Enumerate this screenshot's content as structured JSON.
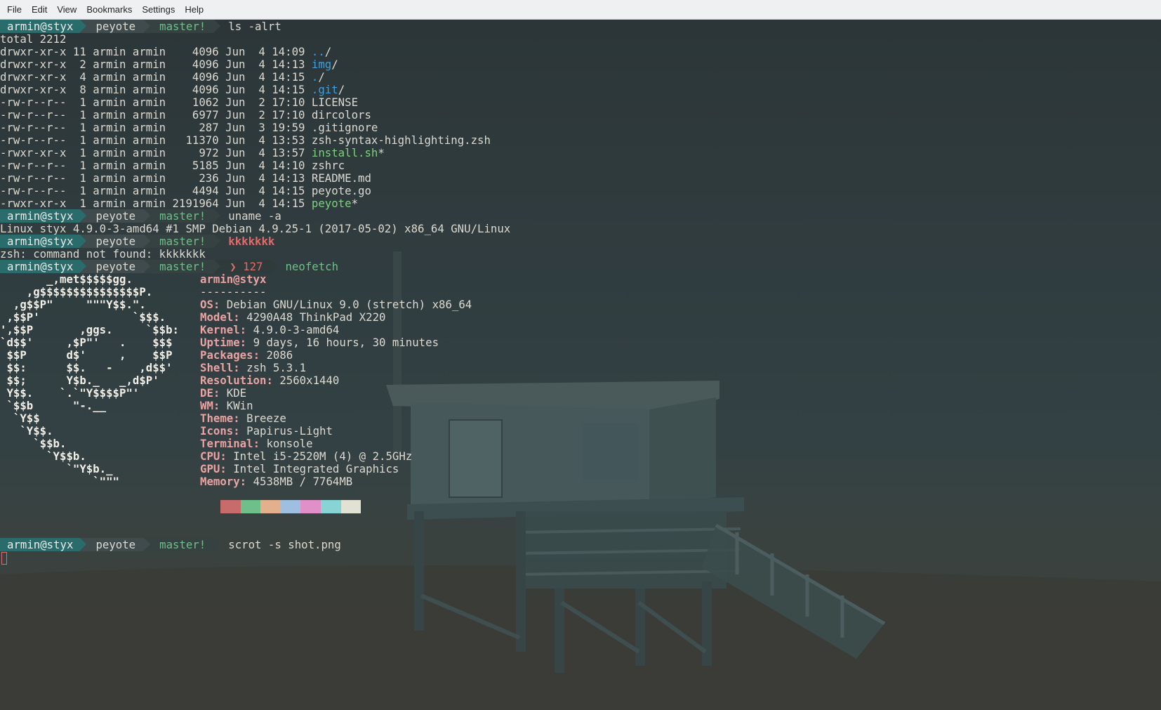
{
  "menubar": {
    "items": [
      "File",
      "Edit",
      "View",
      "Bookmarks",
      "Settings",
      "Help"
    ]
  },
  "prompt": {
    "user": "armin@styx",
    "dir": "peyote",
    "branch": "master!",
    "error_code": "127"
  },
  "commands": {
    "ls": "ls -alrt",
    "uname": "uname -a",
    "bad": "kkkkkkk",
    "neofetch": "neofetch",
    "scrot": "scrot -s shot.png"
  },
  "ls_output": {
    "total": "total 2212",
    "rows": [
      {
        "perm": "drwxr-xr-x 11 armin armin    4096 Jun  4 14:09 ",
        "name": "..",
        "suffix": "/",
        "kind": "dir"
      },
      {
        "perm": "drwxr-xr-x  2 armin armin    4096 Jun  4 14:13 ",
        "name": "img",
        "suffix": "/",
        "kind": "dir"
      },
      {
        "perm": "drwxr-xr-x  4 armin armin    4096 Jun  4 14:15 ",
        "name": ".",
        "suffix": "/",
        "kind": "dir"
      },
      {
        "perm": "drwxr-xr-x  8 armin armin    4096 Jun  4 14:15 ",
        "name": ".git",
        "suffix": "/",
        "kind": "dir"
      },
      {
        "perm": "-rw-r--r--  1 armin armin    1062 Jun  2 17:10 ",
        "name": "LICENSE",
        "suffix": "",
        "kind": "file"
      },
      {
        "perm": "-rw-r--r--  1 armin armin    6977 Jun  2 17:10 ",
        "name": "dircolors",
        "suffix": "",
        "kind": "file"
      },
      {
        "perm": "-rw-r--r--  1 armin armin     287 Jun  3 19:59 ",
        "name": ".gitignore",
        "suffix": "",
        "kind": "file"
      },
      {
        "perm": "-rw-r--r--  1 armin armin   11370 Jun  4 13:53 ",
        "name": "zsh-syntax-highlighting.zsh",
        "suffix": "",
        "kind": "file"
      },
      {
        "perm": "-rwxr-xr-x  1 armin armin     972 Jun  4 13:57 ",
        "name": "install.sh",
        "suffix": "*",
        "kind": "exe"
      },
      {
        "perm": "-rw-r--r--  1 armin armin    5185 Jun  4 14:10 ",
        "name": "zshrc",
        "suffix": "",
        "kind": "file"
      },
      {
        "perm": "-rw-r--r--  1 armin armin     236 Jun  4 14:13 ",
        "name": "README.md",
        "suffix": "",
        "kind": "file"
      },
      {
        "perm": "-rw-r--r--  1 armin armin    4494 Jun  4 14:15 ",
        "name": "peyote.go",
        "suffix": "",
        "kind": "file"
      },
      {
        "perm": "-rwxr-xr-x  1 armin armin 2191964 Jun  4 14:15 ",
        "name": "peyote",
        "suffix": "*",
        "kind": "exe"
      }
    ]
  },
  "uname_output": "Linux styx 4.9.0-3-amd64 #1 SMP Debian 4.9.25-1 (2017-05-02) x86_64 GNU/Linux",
  "error_output": "zsh: command not found: kkkkkkk",
  "neofetch": {
    "ascii": [
      "       _,met$$$$$gg.",
      "    ,g$$$$$$$$$$$$$$$P.",
      "  ,g$$P\"     \"\"\"Y$$.\".",
      " ,$$P'              `$$$.",
      "',$$P       ,ggs.     `$$b:",
      "`d$$'     ,$P\"'   .    $$$",
      " $$P      d$'     ,    $$P",
      " $$:      $$.   -    ,d$$'",
      " $$;      Y$b._   _,d$P'",
      " Y$$.    `.`\"Y$$$$P\"'",
      " `$$b      \"-.__",
      "  `Y$$",
      "   `Y$$.",
      "     `$$b.",
      "       `Y$$b.",
      "          `\"Y$b._",
      "              `\"\"\""
    ],
    "title": "armin@styx",
    "separator": "----------",
    "info": [
      {
        "key": "OS",
        "value": "Debian GNU/Linux 9.0 (stretch) x86_64"
      },
      {
        "key": "Model",
        "value": "4290A48 ThinkPad X220"
      },
      {
        "key": "Kernel",
        "value": "4.9.0-3-amd64"
      },
      {
        "key": "Uptime",
        "value": "9 days, 16 hours, 30 minutes"
      },
      {
        "key": "Packages",
        "value": "2086"
      },
      {
        "key": "Shell",
        "value": "zsh 5.3.1"
      },
      {
        "key": "Resolution",
        "value": "2560x1440"
      },
      {
        "key": "DE",
        "value": "KDE"
      },
      {
        "key": "WM",
        "value": "KWin"
      },
      {
        "key": "Theme",
        "value": "Breeze"
      },
      {
        "key": "Icons",
        "value": "Papirus-Light"
      },
      {
        "key": "Terminal",
        "value": "konsole"
      },
      {
        "key": "CPU",
        "value": "Intel i5-2520M (4) @ 2.5GHz"
      },
      {
        "key": "GPU",
        "value": "Intel Integrated Graphics"
      },
      {
        "key": "Memory",
        "value": "4538MB / 7764MB"
      }
    ],
    "palette": [
      "#c76b6b",
      "#6fbf8a",
      "#e3b08e",
      "#9fbfe0",
      "#e08fc8",
      "#88d4d4",
      "#e2e2d4"
    ]
  },
  "colors": {
    "dir": "#3d9ee0",
    "exe": "#7ed07e",
    "prompt_user_bg": "#2a6b6b",
    "error": "#e06b6b"
  }
}
